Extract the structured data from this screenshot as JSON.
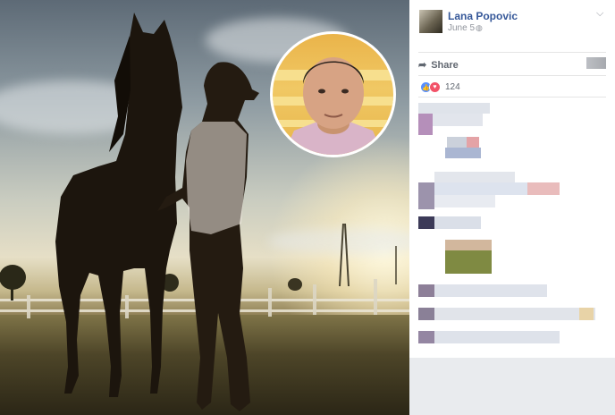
{
  "post": {
    "author": "Lana Popovic",
    "date": "June 5",
    "privacy_icon": "globe-icon",
    "menu_icon": "chevron-down-icon"
  },
  "actions": {
    "share_label": "Share",
    "share_icon": "share-arrow-icon"
  },
  "reactions": {
    "icons": [
      "like-icon",
      "love-icon"
    ],
    "count": "124"
  },
  "photo": {
    "inset_present": true
  },
  "colors": {
    "link_blue": "#365899",
    "like_blue": "#5890ff",
    "love_red": "#f25268",
    "panel_bg": "#ffffff",
    "page_bg": "#e9ebee"
  }
}
